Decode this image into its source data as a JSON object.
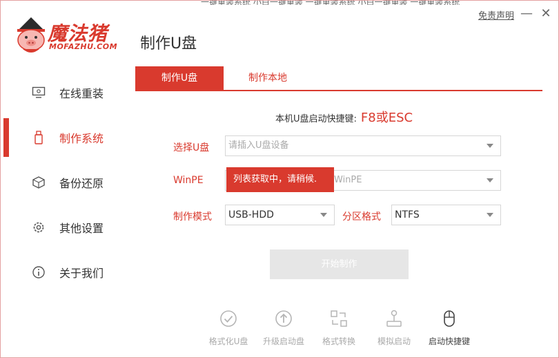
{
  "window": {
    "top_strip_text": "一键重装系统 小白一键重装 一键重装系统 小白一键重装 一键重装系统"
  },
  "logo": {
    "brand_cn": "魔法猪",
    "brand_en": "MOFAZHU.COM"
  },
  "header": {
    "title": "制作U盘",
    "disclaimer": "免责声明",
    "minimize": "—",
    "close": "✕"
  },
  "sidebar": {
    "items": [
      {
        "label": "在线重装",
        "icon": "monitor-icon",
        "active": false
      },
      {
        "label": "制作系统",
        "icon": "usb-drive-icon",
        "active": true
      },
      {
        "label": "备份还原",
        "icon": "box-backup-icon",
        "active": false
      },
      {
        "label": "其他设置",
        "icon": "gear-icon",
        "active": false
      },
      {
        "label": "关于我们",
        "icon": "info-icon",
        "active": false
      }
    ]
  },
  "tabs": [
    {
      "label": "制作U盘",
      "active": true
    },
    {
      "label": "制作本地",
      "active": false
    }
  ],
  "hotkey": {
    "label": "本机U盘启动快捷键:",
    "value": "F8或ESC"
  },
  "form": {
    "usb_label": "选择U盘",
    "usb_placeholder": "请插入U盘设备",
    "winpe_label": "WinPE",
    "winpe_value": "WinPE",
    "mode_label": "制作模式",
    "mode_value": "USB-HDD",
    "partition_label": "分区格式",
    "partition_value": "NTFS",
    "loading_tooltip": "列表获取中，请稍候."
  },
  "start_button": "开始制作",
  "tools": [
    {
      "label": "格式化U盘",
      "icon": "check-circle-icon",
      "enabled": false
    },
    {
      "label": "升级启动盘",
      "icon": "upload-circle-icon",
      "enabled": false
    },
    {
      "label": "格式转换",
      "icon": "convert-icon",
      "enabled": false
    },
    {
      "label": "模拟启动",
      "icon": "joystick-icon",
      "enabled": false
    },
    {
      "label": "启动快捷键",
      "icon": "mouse-icon",
      "enabled": true
    }
  ],
  "colors": {
    "accent": "#d93a2e",
    "disabled": "#aaaaaa",
    "button_disabled_bg": "#e6e6e6"
  }
}
